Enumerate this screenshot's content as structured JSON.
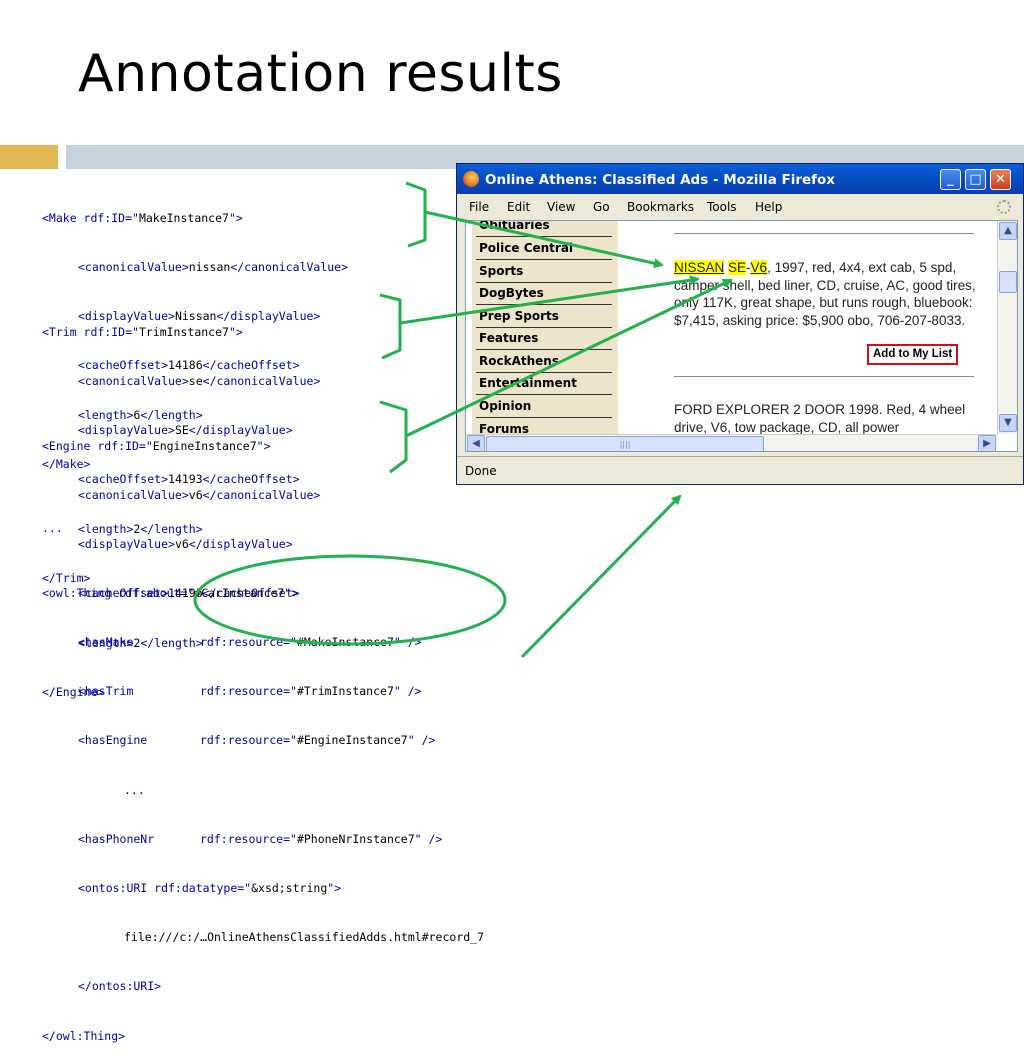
{
  "slide": {
    "title": "Annotation results"
  },
  "code": {
    "make": [
      {
        "tag_open": "<Make rdf:ID=\"",
        "value": "MakeInstance7",
        "tag_close": "\">"
      },
      {
        "a": "<canonicalValue>",
        "v": "nissan",
        "b": "</canonicalValue>"
      },
      {
        "a": "<displayValue>",
        "v": "Nissan",
        "b": "</displayValue>"
      },
      {
        "a": "<cacheOffset>",
        "v": "14186",
        "b": "</cacheOffset>"
      },
      {
        "a": "<length>",
        "v": "6",
        "b": "</length>"
      },
      {
        "end": "</Make>"
      }
    ],
    "trim": [
      {
        "tag_open": "<Trim rdf:ID=\"",
        "value": "TrimInstance7",
        "tag_close": "\">"
      },
      {
        "a": "<canonicalValue>",
        "v": "se",
        "b": "</canonicalValue>"
      },
      {
        "a": "<displayValue>",
        "v": "SE",
        "b": "</displayValue>"
      },
      {
        "a": "<cacheOffset>",
        "v": "14193",
        "b": "</cacheOffset>"
      },
      {
        "a": "<length>",
        "v": "2",
        "b": "</length>"
      },
      {
        "end": "</Trim>"
      }
    ],
    "engine": [
      {
        "tag_open": "<Engine rdf:ID=\"",
        "value": "EngineInstance7",
        "tag_close": "\">"
      },
      {
        "a": "<canonicalValue>",
        "v": "v6",
        "b": "</canonicalValue>"
      },
      {
        "a": "<displayValue>",
        "v": "v6",
        "b": "</displayValue>"
      },
      {
        "a": "<cacheOffset>",
        "v": "14196",
        "b": "</cacheOffset>"
      },
      {
        "a": "<length>",
        "v": "2",
        "b": "</length>"
      },
      {
        "end": "</Engine>"
      }
    ],
    "ellipsis": "...",
    "thing_open_a": "<owl:Thing rdf:about=\"",
    "thing_open_v": "#CarInstance7",
    "thing_open_b": "\">",
    "has_make_tag": "<hasMake",
    "has_make_attr": "rdf:resource=\"",
    "has_make_val": "#MakeInstance7",
    "has_make_end": "\" />",
    "has_trim_tag": "<hasTrim",
    "has_trim_attr": "rdf:resource=\"",
    "has_trim_val": "#TrimInstance7",
    "has_trim_end": "\" />",
    "has_engine_tag": "<hasEngine",
    "has_engine_attr": "rdf:resource=\"",
    "has_engine_val": "#EngineInstance7",
    "has_engine_end": "\" />",
    "inner_ellipsis": "...",
    "has_phone_tag": "<hasPhoneNr",
    "has_phone_attr": "rdf:resource=\"",
    "has_phone_val": "#PhoneNrInstance7",
    "has_phone_end": "\" />",
    "uri_open_a": "<ontos:URI rdf:datatype=\"",
    "uri_open_v": "&xsd;string",
    "uri_open_b": "\">",
    "uri_value": "file:///c:/…OnlineAthensClassifiedAdds.html#record_7",
    "uri_close": "</ontos:URI>",
    "thing_close": "</owl:Thing>"
  },
  "browser": {
    "title": "Online Athens: Classified Ads - Mozilla Firefox",
    "buttons": {
      "minimize": "_",
      "maximize": "□",
      "close": "✕"
    },
    "menu": [
      "File",
      "Edit",
      "View",
      "Go",
      "Bookmarks",
      "Tools",
      "Help"
    ],
    "nav": [
      "Obituaries",
      "Police Central",
      "Sports",
      "DogBytes",
      "Prep Sports",
      "Features",
      "RockAthens",
      "Entertainment",
      "Opinion",
      "Forums"
    ],
    "ad1": {
      "make": "NISSAN",
      "trim": "SE",
      "dash": "-",
      "engine": "V6",
      "rest": ", 1997, red, 4x4, ext cab, 5 spd, camper shell, bed liner, CD, cruise, AC, good tires, only 117K, great shape, but runs rough, bluebook: $7,415, asking price: $5,900 obo, 706-207-8033."
    },
    "add_button": "Add to My List",
    "ad2": "FORD EXPLORER 2 DOOR 1998. Red, 4 wheel drive, V6, tow package, CD, all power",
    "status": "Done",
    "scroll_up": "▲",
    "scroll_down": "▼",
    "scroll_left": "◀",
    "scroll_right": "▶",
    "hthumb_grip": "||||"
  },
  "colors": {
    "annotation_green": "#22b14c",
    "tag_blue": "#0000a0",
    "highlight": "#ffff00",
    "accent_bar": "#e2b953",
    "main_bar": "#c6d2dc"
  }
}
